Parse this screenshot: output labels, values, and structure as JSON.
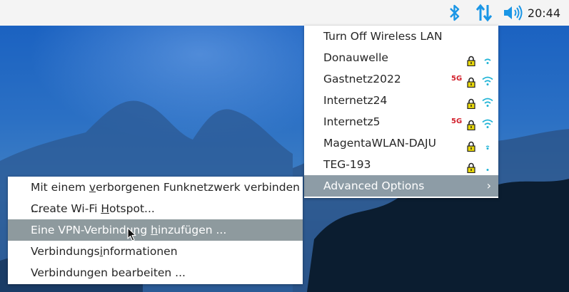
{
  "panel": {
    "clock": "20:44",
    "icons": [
      "bluetooth-icon",
      "network-arrows-icon",
      "volume-icon"
    ],
    "accent_color": "#1a96e6"
  },
  "network_menu": {
    "turn_off": "Turn Off Wireless LAN",
    "networks": [
      {
        "ssid": "Donauwelle",
        "band5g": "",
        "secured": true,
        "signal": "weak"
      },
      {
        "ssid": "Gastnetz2022",
        "band5g": "5G",
        "secured": true,
        "signal": "strong"
      },
      {
        "ssid": "Internetz24",
        "band5g": "",
        "secured": true,
        "signal": "strong"
      },
      {
        "ssid": "Internetz5",
        "band5g": "5G",
        "secured": true,
        "signal": "strong"
      },
      {
        "ssid": "MagentaWLAN-DAJU",
        "band5g": "",
        "secured": true,
        "signal": "very-weak"
      },
      {
        "ssid": "TEG-193",
        "band5g": "",
        "secured": true,
        "signal": "very-weak"
      }
    ],
    "advanced": "Advanced Options",
    "chevron": "›"
  },
  "advanced_menu": {
    "hidden_network": {
      "pre": "Mit einem ",
      "u": "v",
      "post": "erborgenen Funknetzwerk verbinden ..."
    },
    "hotspot": {
      "pre": "Create Wi-Fi ",
      "u": "H",
      "post": "otspot..."
    },
    "add_vpn": {
      "pre": "Eine VPN-Verbindung ",
      "u": "h",
      "post": "inzufügen ..."
    },
    "info": {
      "pre": "Verbindungs",
      "u": "i",
      "post": "nformationen"
    },
    "edit": {
      "pre": "Verbindungen bearbeiten ...",
      "u": "",
      "post": ""
    }
  }
}
